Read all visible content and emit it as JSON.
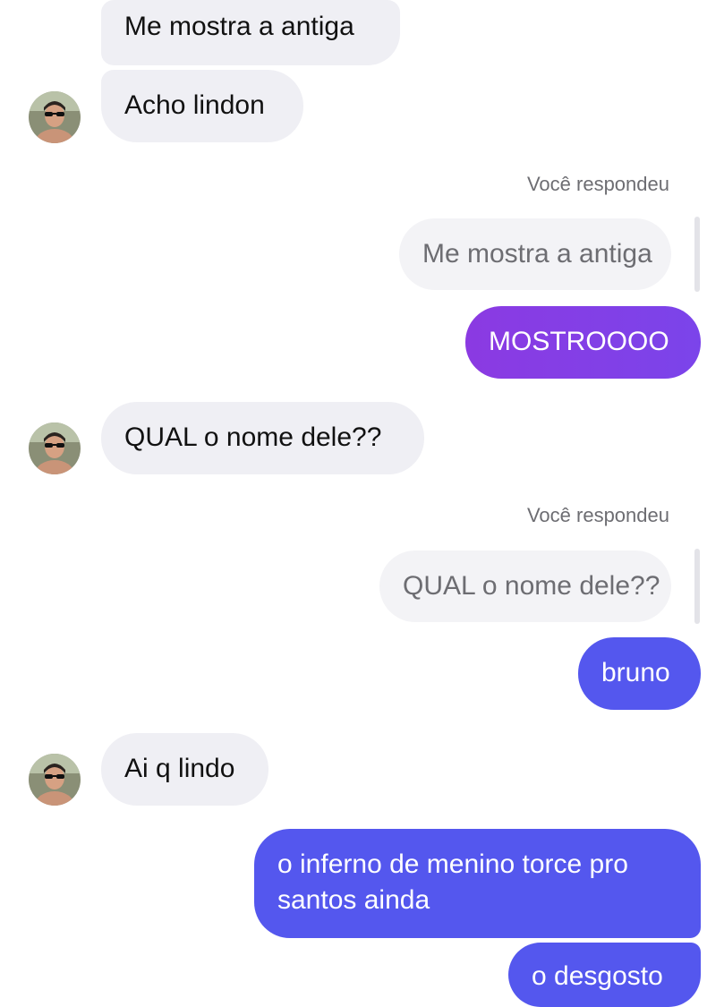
{
  "messages": {
    "m1": "Me mostra a antiga",
    "m2": "Acho lindon",
    "reply1_label": "Você respondeu",
    "reply1_quote": "Me mostra a antiga",
    "m3": "MOSTROOOO",
    "m4": "QUAL o nome dele??",
    "reply2_label": "Você respondeu",
    "reply2_quote": "QUAL o nome dele??",
    "m5": "bruno",
    "m6": "Ai q lindo",
    "m7": "o inferno de menino torce pro santos ainda",
    "m8": "o desgosto"
  },
  "colors": {
    "incoming_bubble": "#efeff4",
    "outgoing_purple": "#8b3ae2",
    "outgoing_indigo": "#5457ee",
    "quote_text": "#6d6d72"
  },
  "icons": {
    "avatar": "contact-avatar-photo"
  }
}
